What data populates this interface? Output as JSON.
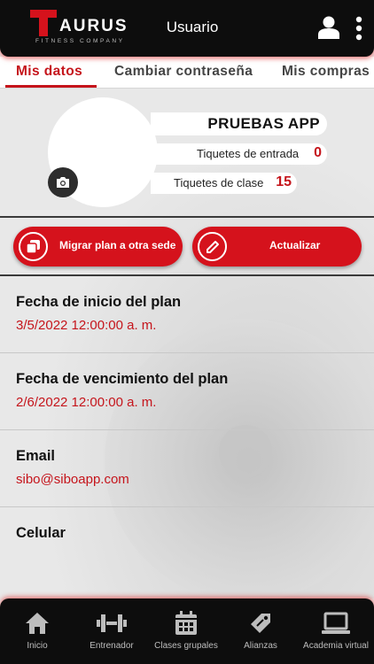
{
  "header": {
    "logo_text": "AURUS",
    "logo_subtext": "FITNESS COMPANY",
    "title": "Usuario",
    "user_icon": "user-icon",
    "menu_icon": "kebab-menu-icon"
  },
  "tabs": [
    {
      "label": "Mis datos",
      "active": true
    },
    {
      "label": "Cambiar contraseña",
      "active": false
    },
    {
      "label": "Mis compras",
      "active": false
    }
  ],
  "profile": {
    "name": "PRUEBAS APP",
    "entry_tickets_label": "Tiquetes de entrada",
    "entry_tickets_value": "0",
    "class_tickets_label": "Tiquetes de clase",
    "class_tickets_value": "15",
    "camera_icon": "camera-icon"
  },
  "actions": {
    "migrate_label": "Migrar plan a otra sede",
    "update_label": "Actualizar"
  },
  "fields": [
    {
      "label": "Fecha de inicio del plan",
      "value": "3/5/2022 12:00:00 a. m."
    },
    {
      "label": "Fecha de vencimiento del plan",
      "value": "2/6/2022 12:00:00 a. m."
    },
    {
      "label": "Email",
      "value": "sibo@siboapp.com"
    },
    {
      "label": "Celular",
      "value": ""
    }
  ],
  "bottom_nav": [
    {
      "label": "Inicio",
      "icon": "home-icon"
    },
    {
      "label": "Entrenador",
      "icon": "dumbbell-icon"
    },
    {
      "label": "Clases grupales",
      "icon": "calendar-icon"
    },
    {
      "label": "Alianzas",
      "icon": "tag-icon"
    },
    {
      "label": "Academia virtual",
      "icon": "laptop-icon"
    }
  ],
  "colors": {
    "accent": "#d5121c",
    "accent_text": "#c5141b",
    "header_bg": "#0d0d0d"
  }
}
